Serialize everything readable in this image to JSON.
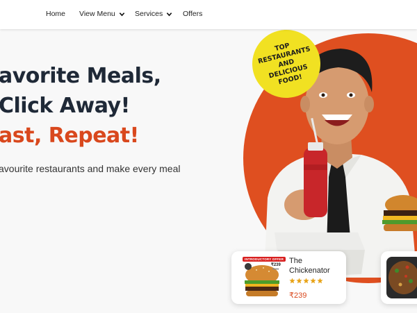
{
  "nav": {
    "items": [
      {
        "label": "Home"
      },
      {
        "label": "View Menu"
      },
      {
        "label": "Services"
      },
      {
        "label": "Offers"
      }
    ]
  },
  "hero": {
    "line1": "avorite Meals,",
    "line2": "Click Away!",
    "line3": "ast, Repeat!",
    "subtitle": "avourite restaurants and make every meal"
  },
  "badge": {
    "text": "TOP RESTAURANTS AND DELICIOUS FOOD!"
  },
  "cards": [
    {
      "tag": "INTRODUCTORY OFFER",
      "mini_price": "₹239",
      "mini_old_price": "₹299",
      "title_line1": "The",
      "title_line2": "Chickenator",
      "rating": 5,
      "price": "₹239"
    }
  ],
  "colors": {
    "accent": "#d9481d",
    "circle": "#df4f20",
    "badge": "#f1e122",
    "star": "#e8a317",
    "heading": "#1f2937"
  }
}
